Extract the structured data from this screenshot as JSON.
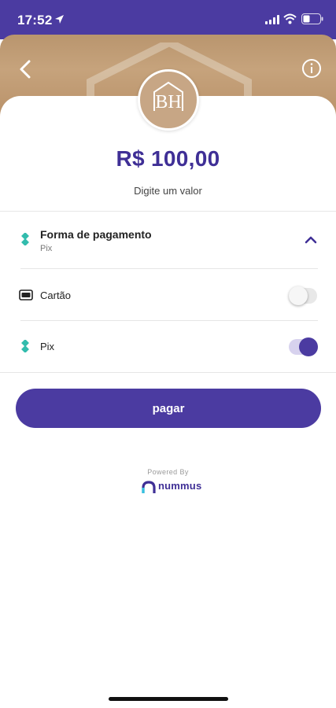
{
  "status_bar": {
    "time": "17:52"
  },
  "merchant": {
    "logo_text": "BH"
  },
  "amount": {
    "value": "R$ 100,00",
    "hint": "Digite um valor"
  },
  "payment": {
    "title": "Forma de pagamento",
    "selected": "Pix",
    "options": [
      {
        "label": "Cartão",
        "enabled": false
      },
      {
        "label": "Pix",
        "enabled": true
      }
    ]
  },
  "actions": {
    "pay_label": "pagar"
  },
  "footer": {
    "powered_by": "Powered By",
    "brand": "nummus"
  },
  "colors": {
    "primary": "#4b3ba1",
    "amount_text": "#3f2f96",
    "pix_green": "#32bcad"
  }
}
